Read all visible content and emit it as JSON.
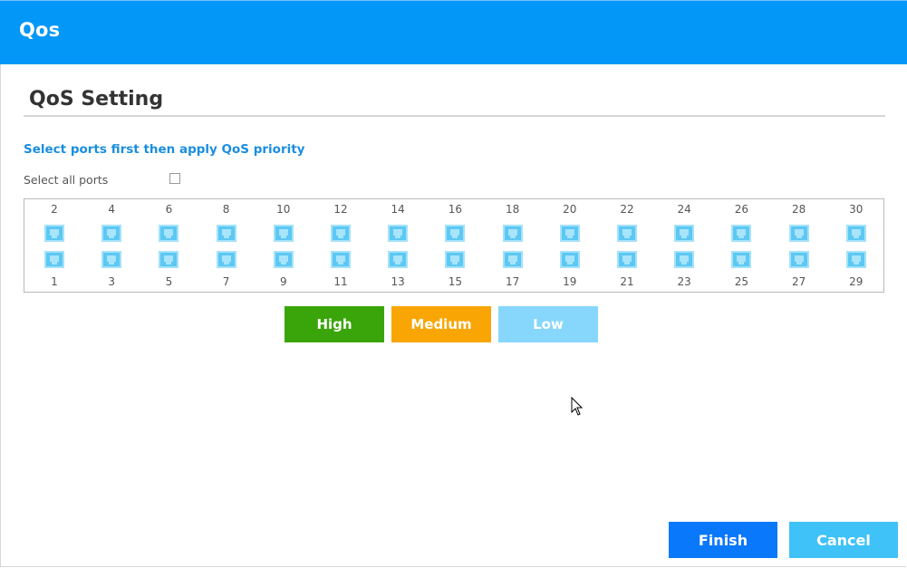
{
  "header": {
    "title": "Qos"
  },
  "section": {
    "title": "QoS Setting"
  },
  "instruction": "Select ports first then apply QoS priority",
  "select_all": {
    "label": "Select all ports",
    "checked": false
  },
  "ports": {
    "top_row": [
      "2",
      "4",
      "6",
      "8",
      "10",
      "12",
      "14",
      "16",
      "18",
      "20",
      "22",
      "24",
      "26",
      "28",
      "30"
    ],
    "bottom_row": [
      "1",
      "3",
      "5",
      "7",
      "9",
      "11",
      "13",
      "15",
      "17",
      "19",
      "21",
      "23",
      "25",
      "27",
      "29"
    ]
  },
  "priority": {
    "high": "High",
    "medium": "Medium",
    "low": "Low",
    "colors": {
      "high": "#3aa50a",
      "medium": "#f9a605",
      "low": "#87d6fc"
    }
  },
  "actions": {
    "finish": "Finish",
    "cancel": "Cancel"
  },
  "colors": {
    "header": "#0397f7",
    "accent_text": "#1a8ee0",
    "finish": "#0a78fa",
    "cancel": "#3fc2f8"
  }
}
